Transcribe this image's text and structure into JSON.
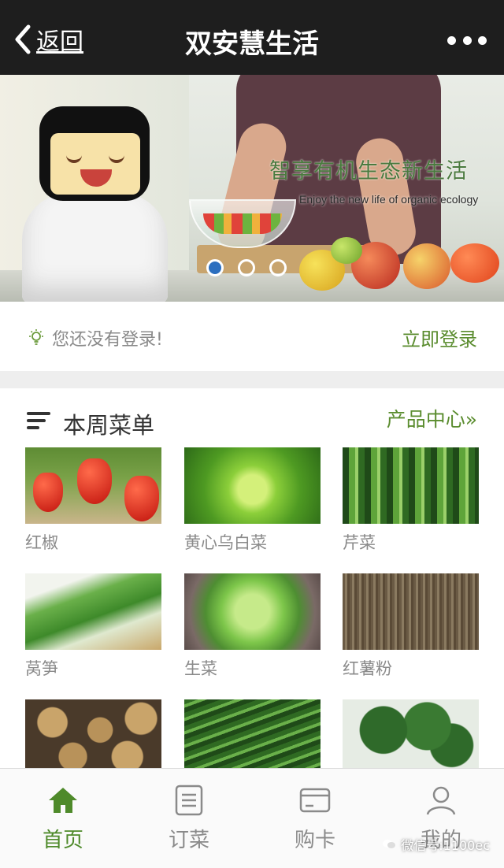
{
  "nav": {
    "back_label": "返回",
    "title": "双安慧生活"
  },
  "banner": {
    "headline": "智享有机生态新生活",
    "subtitle": "Enjoy the new life of organic ecology",
    "slide_count": 3,
    "active_slide": 1
  },
  "login": {
    "hint": "您还没有登录!",
    "action": "立即登录"
  },
  "section": {
    "title": "本周菜单",
    "link": "产品中心»"
  },
  "products": [
    {
      "name": "红椒",
      "icon": "red-pepper-photo"
    },
    {
      "name": "黄心乌白菜",
      "icon": "bok-choy-photo"
    },
    {
      "name": "芹菜",
      "icon": "celery-photo"
    },
    {
      "name": "莴笋",
      "icon": "lettuce-stem-photo"
    },
    {
      "name": "生菜",
      "icon": "lettuce-photo"
    },
    {
      "name": "红薯粉",
      "icon": "sweet-potato-noodle-photo"
    },
    {
      "name": "",
      "icon": "potato-photo"
    },
    {
      "name": "",
      "icon": "scallion-photo"
    },
    {
      "name": "",
      "icon": "broccoli-photo"
    }
  ],
  "tabs": [
    {
      "label": "首页",
      "icon": "home-icon",
      "active": true
    },
    {
      "label": "订菜",
      "icon": "order-list-icon",
      "active": false
    },
    {
      "label": "购卡",
      "icon": "card-icon",
      "active": false
    },
    {
      "label": "我的",
      "icon": "user-icon",
      "active": false
    }
  ],
  "watermark": "微信号:1100ec",
  "colors": {
    "accent_green": "#5a8c2e",
    "navbar": "#1e1e1e",
    "active_dot": "#2c6fbf"
  }
}
